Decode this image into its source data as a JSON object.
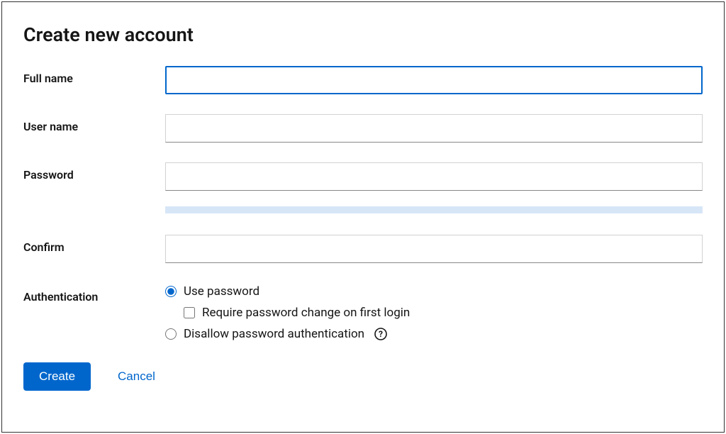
{
  "title": "Create new account",
  "fields": {
    "full_name": {
      "label": "Full name",
      "value": ""
    },
    "user_name": {
      "label": "User name",
      "value": ""
    },
    "password": {
      "label": "Password",
      "value": ""
    },
    "confirm": {
      "label": "Confirm",
      "value": ""
    }
  },
  "authentication": {
    "label": "Authentication",
    "options": {
      "use_password": {
        "label": "Use password",
        "selected": true
      },
      "require_change": {
        "label": "Require password change on first login",
        "checked": false
      },
      "disallow": {
        "label": "Disallow password authentication",
        "selected": false
      }
    }
  },
  "buttons": {
    "create": "Create",
    "cancel": "Cancel"
  }
}
